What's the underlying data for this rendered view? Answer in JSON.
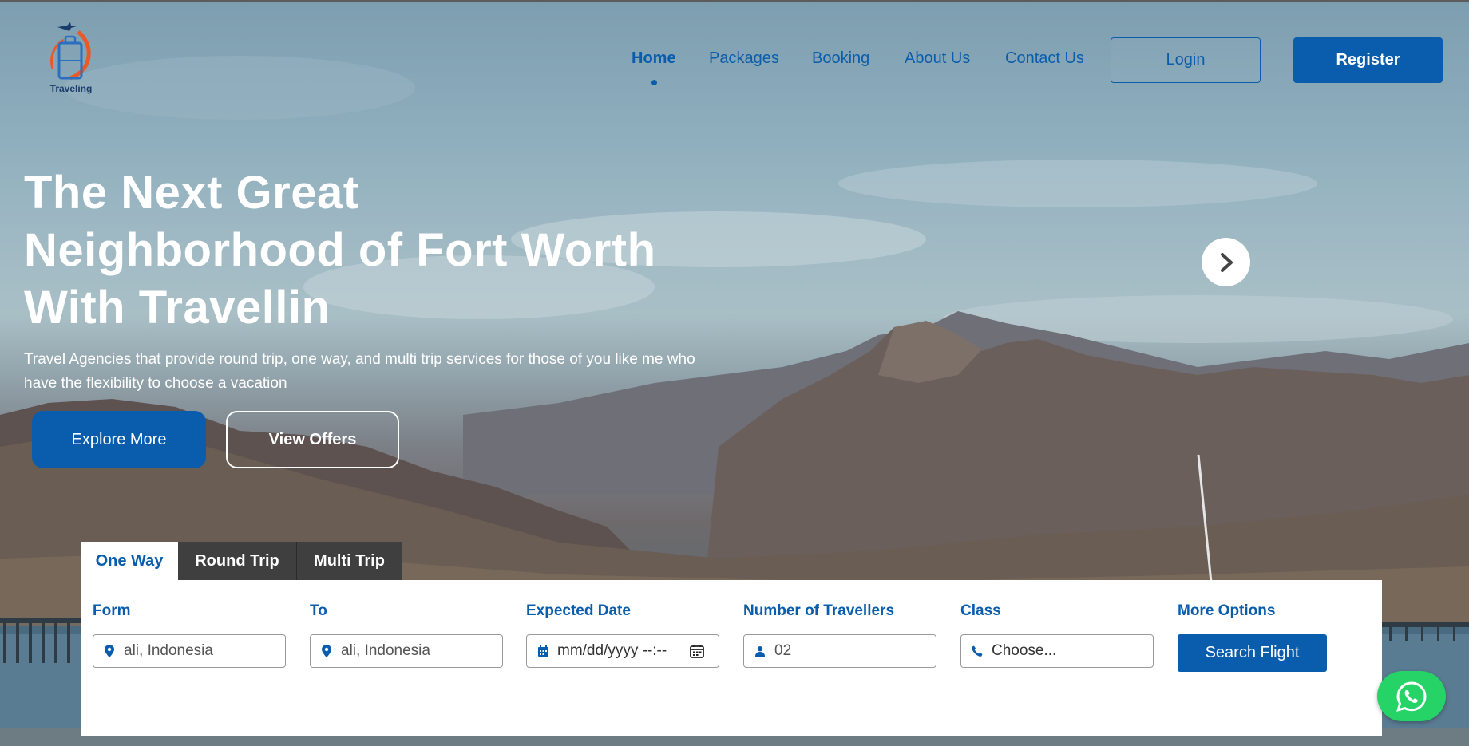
{
  "brand": {
    "logo_text": "Traveling",
    "logo_name": "suitcase-airplane-logo"
  },
  "nav": {
    "items": [
      {
        "label": "Home",
        "active": true
      },
      {
        "label": "Packages",
        "active": false
      },
      {
        "label": "Booking",
        "active": false
      },
      {
        "label": "About Us",
        "active": false
      },
      {
        "label": "Contact Us",
        "active": false
      }
    ],
    "login_label": "Login",
    "register_label": "Register"
  },
  "hero": {
    "headline_lines": [
      "The Next Great",
      "Neighborhood of Fort Worth",
      "With Travellin"
    ],
    "subtext": "Travel Agencies that provide round trip, one way, and multi trip services for those of you like me who have the flexibility to choose a vacation",
    "explore_label": "Explore More",
    "offers_label": "View Offers",
    "next_icon": "chevron-right-icon"
  },
  "booking": {
    "tabs": [
      {
        "label": "One Way",
        "active": true
      },
      {
        "label": "Round Trip",
        "active": false
      },
      {
        "label": "Multi Trip",
        "active": false
      }
    ],
    "fields": {
      "from": {
        "label": "Form",
        "value": "ali, Indonesia",
        "icon": "location-pin-icon"
      },
      "to": {
        "label": "To",
        "value": "ali, Indonesia",
        "icon": "location-pin-icon"
      },
      "date": {
        "label": "Expected Date",
        "value": "mm/dd/yyyy --:--",
        "icon": "calendar-icon"
      },
      "travellers": {
        "label": "Number of Travellers",
        "value": "02",
        "icon": "person-icon"
      },
      "class": {
        "label": "Class",
        "value": "Choose...",
        "icon": "phone-icon"
      },
      "more": {
        "label": "More Options"
      }
    },
    "search_label": "Search Flight"
  },
  "colors": {
    "primary": "#0a5dac",
    "whatsapp": "#25d366",
    "tab_dark": "#3f3f3f"
  },
  "floating": {
    "icon": "whatsapp-icon"
  }
}
